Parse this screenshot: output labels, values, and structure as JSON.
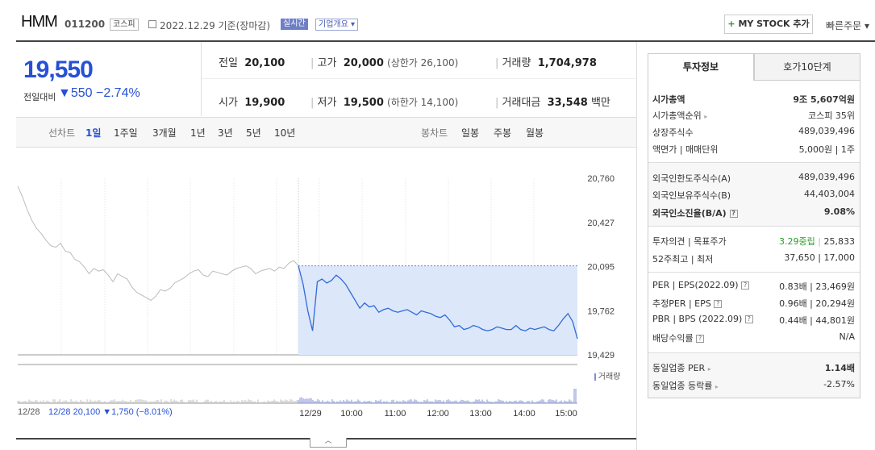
{
  "header": {
    "name": "HMM",
    "code": "011200",
    "market": "코스피",
    "date": "2022.12.29 기준(장마감)",
    "realtime": "실시간",
    "overview": "기업개요 ▾",
    "mystock_plus": "+",
    "mystock": "MY STOCK 추가",
    "quick": "빠른주문 ▾"
  },
  "price": {
    "current": "19,550",
    "change_label": "전일대비",
    "change": "▼550",
    "change_pct": "−2.74%"
  },
  "stats": {
    "prev_label": "전일",
    "prev": "20,100",
    "high_label": "고가",
    "high": "20,000",
    "high_limit": "(상한가 26,100)",
    "volume_label": "거래량",
    "volume": "1,704,978",
    "open_label": "시가",
    "open": "19,900",
    "low_label": "저가",
    "low": "19,500",
    "low_limit": "(하한가 14,100)",
    "amount_label": "거래대금",
    "amount": "33,548",
    "amount_unit": "백만"
  },
  "toolbar": {
    "line_label": "선차트",
    "line_items": [
      "1일",
      "1주일",
      "3개월",
      "1년",
      "3년",
      "5년",
      "10년"
    ],
    "candle_label": "봉차트",
    "candle_items": [
      "일봉",
      "주봉",
      "월봉"
    ]
  },
  "sidebar": {
    "tab_info": "투자정보",
    "tab_hoga": "호가10단계",
    "mcap_label": "시가총액",
    "mcap": "9조 5,607억원",
    "rank_label": "시가총액순위",
    "rank": "코스피 35위",
    "shares_label": "상장주식수",
    "shares": "489,039,496",
    "par_label": "액면가 | 매매단위",
    "par": "5,000원 | 1주",
    "fl_label": "외국인한도주식수(A)",
    "fl": "489,039,496",
    "fh_label": "외국인보유주식수(B)",
    "fh": "44,403,004",
    "fr_label": "외국인소진율(B/A)",
    "fr": "9.08%",
    "opinion_label": "투자의견 | 목표주가",
    "opinion": "3.29중립",
    "target": "25,833",
    "w52_label": "52주최고 | 최저",
    "w52": "37,650 | 17,000",
    "per_label": "PER | EPS(2022.09)",
    "per": "0.83배 | 23,469원",
    "eper_label": "추정PER | EPS",
    "eper": "0.96배 | 20,294원",
    "pbr_label": "PBR | BPS (2022.09)",
    "pbr": "0.44배 | 44,801원",
    "div_label": "배당수익률",
    "div": "N/A",
    "ind_per_label": "동일업종 PER",
    "ind_per": "1.14배",
    "ind_rate_label": "동일업종 등락률",
    "ind_rate": "-2.57%"
  },
  "chart_data": {
    "type": "line",
    "y_ticks": [
      "20,760",
      "20,427",
      "20,095",
      "19,762",
      "19,429"
    ],
    "ylim": [
      19429,
      20760
    ],
    "prev_close": 20100,
    "volume_label": "거래량",
    "x_labels": [
      "12/28",
      "12/29",
      "10:00",
      "11:00",
      "12:00",
      "13:00",
      "14:00",
      "15:00"
    ],
    "prev_day_info": "12/28  20,100 ▼1,750 (−8.01%)",
    "series": [
      {
        "values": [
          20700,
          20620,
          20520,
          20440,
          20380,
          20340,
          20290,
          20250,
          20240,
          20270,
          20210,
          20200,
          20150,
          20130,
          20090,
          20040,
          20080,
          20060,
          20070,
          20030,
          19980,
          20040,
          20020,
          20000,
          19940,
          19900,
          19880,
          19860,
          19840,
          19870,
          19920,
          19910,
          19930,
          19970,
          19990,
          20010,
          20040,
          20060,
          20070,
          20030,
          20020,
          20060,
          20050,
          20040,
          20030,
          20060,
          20080,
          20090,
          20100,
          20080,
          20040,
          20060,
          20070,
          20080,
          20060,
          20090,
          20080,
          20120,
          20140,
          20100
        ]
      },
      {
        "values": [
          20100,
          19960,
          19760,
          19610,
          19980,
          20000,
          19970,
          19990,
          20030,
          20000,
          19960,
          19900,
          19840,
          19780,
          19820,
          19790,
          19800,
          19750,
          19770,
          19780,
          19760,
          19750,
          19760,
          19770,
          19750,
          19730,
          19760,
          19750,
          19740,
          19720,
          19710,
          19730,
          19690,
          19640,
          19650,
          19620,
          19630,
          19650,
          19640,
          19620,
          19610,
          19620,
          19640,
          19630,
          19620,
          19620,
          19650,
          19620,
          19610,
          19630,
          19620,
          19630,
          19640,
          19620,
          19610,
          19650,
          19700,
          19740,
          19680,
          19550
        ]
      }
    ]
  }
}
